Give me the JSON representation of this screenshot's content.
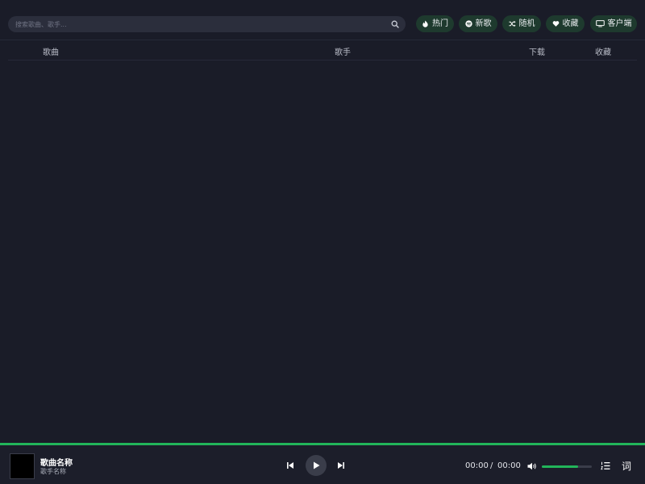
{
  "search": {
    "placeholder": "搜索歌曲、歌手..."
  },
  "nav": [
    {
      "label": "热门",
      "icon": "fire-icon"
    },
    {
      "label": "新歌",
      "icon": "spotify-icon"
    },
    {
      "label": "随机",
      "icon": "shuffle-icon"
    },
    {
      "label": "收藏",
      "icon": "heart-icon"
    },
    {
      "label": "客户端",
      "icon": "desktop-icon"
    }
  ],
  "table": {
    "columns": [
      "歌曲",
      "歌手",
      "下载",
      "收藏"
    ],
    "rows": []
  },
  "player": {
    "title": "歌曲名称",
    "artist": "歌手名称",
    "current_time": "00:00",
    "separator": "/",
    "duration": "00:00",
    "volume": 0.72,
    "lyrics_label": "词"
  },
  "colors": {
    "background": "#1a1c28",
    "accent": "#22b55a",
    "button_bg": "#1e3a2e"
  }
}
